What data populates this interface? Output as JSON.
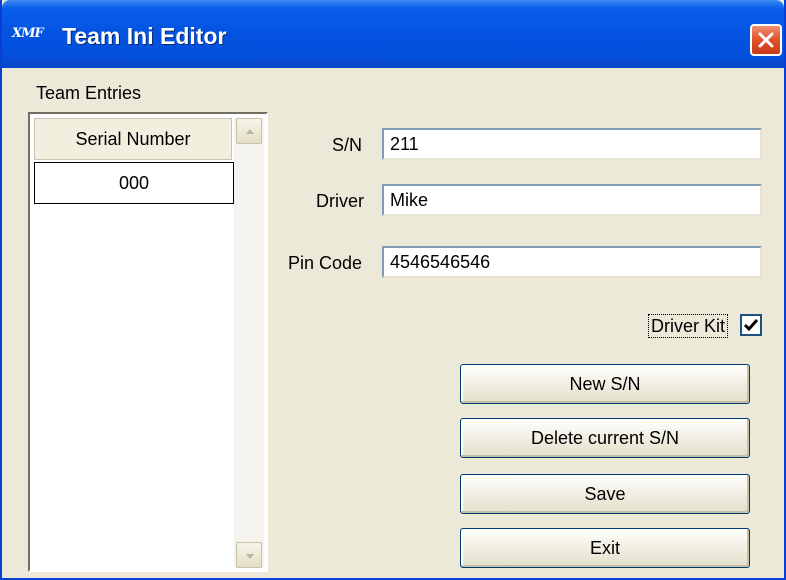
{
  "window": {
    "title": "Team Ini Editor",
    "app_icon_text": "XMF"
  },
  "team_entries": {
    "label": "Team Entries",
    "column_header": "Serial Number",
    "rows": [
      "000"
    ]
  },
  "form": {
    "sn_label": "S/N",
    "sn_value": "211",
    "driver_label": "Driver",
    "driver_value": "Mike",
    "pin_label": "Pin Code",
    "pin_value": "4546546546",
    "driver_kit_label": "Driver Kit",
    "driver_kit_checked": true
  },
  "buttons": {
    "new_sn": "New S/N",
    "delete_sn": "Delete current S/N",
    "save": "Save",
    "exit": "Exit"
  },
  "colors": {
    "titlebar": "#0454E2",
    "close": "#E2502A",
    "window_bg": "#ECE9D8"
  }
}
